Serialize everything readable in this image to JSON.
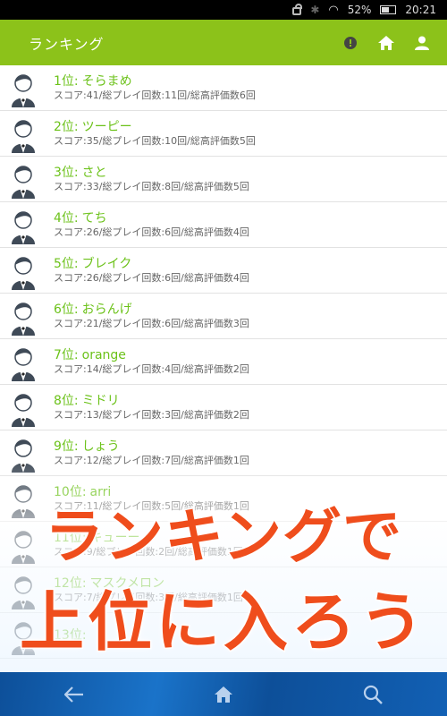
{
  "status_bar": {
    "battery": "52%",
    "time": "20:21"
  },
  "app_bar": {
    "title": "ランキング"
  },
  "rankings": [
    {
      "rank": "1位:",
      "name": "そらまめ",
      "stats": "スコア:41/総プレイ回数:11回/総高評価数6回"
    },
    {
      "rank": "2位:",
      "name": "ツーピー",
      "stats": "スコア:35/総プレイ回数:10回/総高評価数5回"
    },
    {
      "rank": "3位:",
      "name": "さと",
      "stats": "スコア:33/総プレイ回数:8回/総高評価数5回"
    },
    {
      "rank": "4位:",
      "name": "てち",
      "stats": "スコア:26/総プレイ回数:6回/総高評価数4回"
    },
    {
      "rank": "5位:",
      "name": "ブレイク",
      "stats": "スコア:26/総プレイ回数:6回/総高評価数4回"
    },
    {
      "rank": "6位:",
      "name": "おらんげ",
      "stats": "スコア:21/総プレイ回数:6回/総高評価数3回"
    },
    {
      "rank": "7位:",
      "name": "orange",
      "stats": "スコア:14/総プレイ回数:4回/総高評価数2回"
    },
    {
      "rank": "8位:",
      "name": "ミドリ",
      "stats": "スコア:13/総プレイ回数:3回/総高評価数2回"
    },
    {
      "rank": "9位:",
      "name": "しょう",
      "stats": "スコア:12/総プレイ回数:7回/総高評価数1回"
    },
    {
      "rank": "10位:",
      "name": "arri",
      "stats": "スコア:11/総プレイ回数:5回/総高評価数1回"
    },
    {
      "rank": "11位:",
      "name": "キューー",
      "stats": "スコア:9/総プレイ回数:2回/総高評価数1回"
    },
    {
      "rank": "12位:",
      "name": "マスクメロン",
      "stats": "スコア:7/総プレイ回数:3回/総高評価数1回"
    },
    {
      "rank": "13位:",
      "name": "",
      "stats": ""
    }
  ],
  "overlay": {
    "line1": "ランキングで",
    "line2": "上位に入ろう"
  },
  "icons": {
    "info": "info-icon",
    "home": "home-icon",
    "account": "account-icon",
    "back": "back-arrow-icon",
    "nav_home": "home-icon",
    "search": "search-icon"
  }
}
